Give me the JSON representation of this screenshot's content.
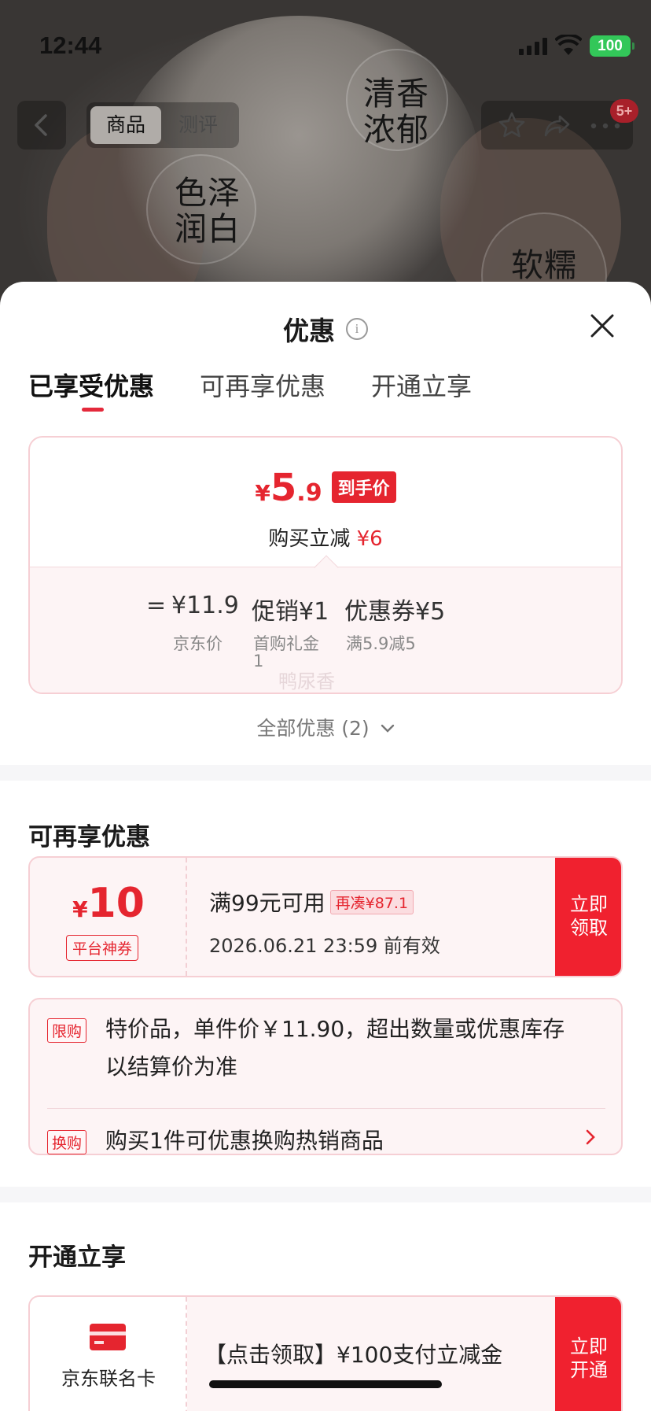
{
  "status_bar": {
    "time": "12:44",
    "battery": "100"
  },
  "hero": {
    "words": [
      "清香",
      "浓郁",
      "色泽",
      "润白",
      "软糯"
    ]
  },
  "top_nav": {
    "tabs": [
      "商品",
      "测评"
    ],
    "badge": "5+"
  },
  "sheet": {
    "title": "优惠",
    "tabs": [
      "已享受优惠",
      "可再享优惠",
      "开通立享"
    ],
    "price_card": {
      "yen": "¥",
      "price_int": "5",
      "price_dec": ".9",
      "price_tag": "到手价",
      "sub_label": "购买立减",
      "sub_value": "¥6",
      "formula": {
        "equals": "=",
        "base": "¥11.9",
        "minus1": "–",
        "promo": "促销¥1",
        "minus2": "–",
        "coupon": "优惠券¥5"
      },
      "labels": {
        "base": "京东价",
        "promo_line1": "首购礼金",
        "promo_line2": "1",
        "coupon": "满5.9减5"
      },
      "watermark": "鸭尿香"
    },
    "all_offers": "全部优惠 (2)",
    "more_section": {
      "title": "可再享优惠",
      "coupon": {
        "yen": "¥",
        "amount": "10",
        "type": "平台神券",
        "condition": "满99元可用",
        "add_more": "再凑¥87.1",
        "expiry": "2026.06.21 23:59 前有效",
        "button_line1": "立即",
        "button_line2": "领取"
      },
      "limits": [
        {
          "tag": "限购",
          "text_line1": "特价品，单件价￥11.90，超出数量或优惠库存",
          "text_line2": "以结算价为准"
        },
        {
          "tag": "换购",
          "text": "购买1件可优惠换购热销商品"
        }
      ]
    },
    "open_section": {
      "title": "开通立享",
      "card": {
        "name": "京东联名卡",
        "text": "【点击领取】¥100支付立减金",
        "button_line1": "立即",
        "button_line2": "开通"
      }
    }
  }
}
